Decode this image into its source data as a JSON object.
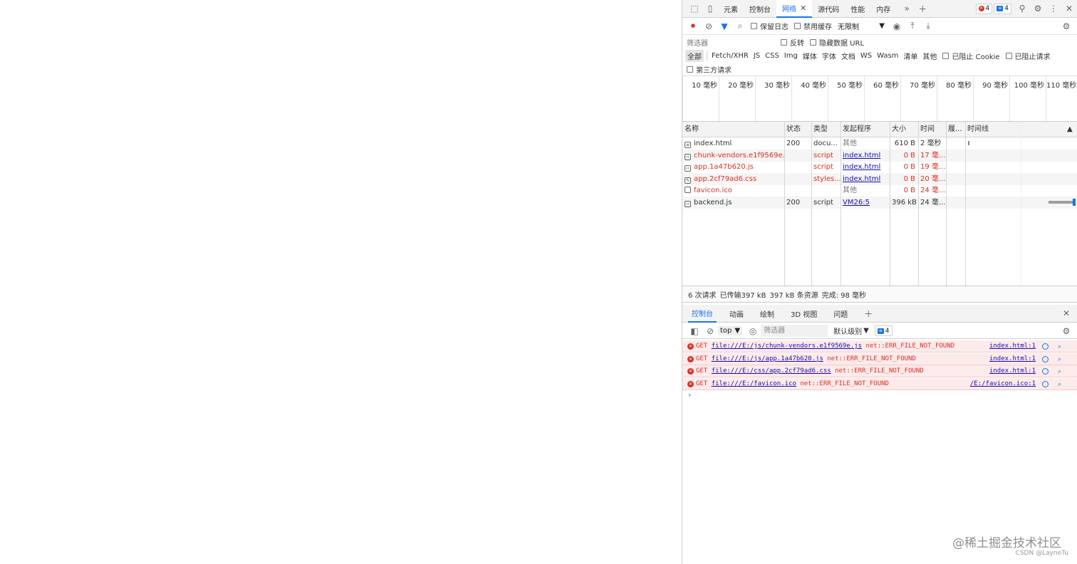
{
  "colors": {
    "accent": "#1a73e8",
    "error": "#d93025",
    "error_bg": "#fcebeb",
    "link": "#1a0dab"
  },
  "tabs": [
    {
      "label": "元素"
    },
    {
      "label": "控制台"
    },
    {
      "label": "网络",
      "active": true
    },
    {
      "label": "源代码"
    },
    {
      "label": "性能"
    },
    {
      "label": "内存"
    }
  ],
  "badges": {
    "errors": "4",
    "messages": "4"
  },
  "toolbar": {
    "preserve_log": "保留日志",
    "disable_cache": "禁用缓存",
    "throttle": "无限制"
  },
  "filter": {
    "placeholder": "筛选器",
    "invert": "反转",
    "hide_data_urls": "隐藏数据 URL"
  },
  "types": [
    "全部",
    "Fetch/XHR",
    "JS",
    "CSS",
    "Img",
    "媒体",
    "字体",
    "文档",
    "WS",
    "Wasm",
    "清单",
    "其他"
  ],
  "blocked_cookies": "已阻止 Cookie",
  "blocked_requests": "已阻止请求",
  "third_party": "第三方请求",
  "overview_ticks": [
    "10 毫秒",
    "20 毫秒",
    "30 毫秒",
    "40 毫秒",
    "50 毫秒",
    "60 毫秒",
    "70 毫秒",
    "80 毫秒",
    "90 毫秒",
    "100 毫秒",
    "110 毫秒"
  ],
  "columns": {
    "name": "名称",
    "status": "状态",
    "type": "类型",
    "initiator": "发起程序",
    "size": "大小",
    "time": "时间",
    "priority": "履...",
    "waterfall": "时间线"
  },
  "rows": [
    {
      "name": "index.html",
      "status": "200",
      "type": "docu...",
      "initiator": "其他",
      "size": "610 B",
      "time": "2 毫秒",
      "error": false
    },
    {
      "name": "chunk-vendors.e1f9569e.js",
      "status": "",
      "type": "script",
      "initiator": "index.html",
      "size": "0 B",
      "time": "17 毫...",
      "error": true
    },
    {
      "name": "app.1a47b620.js",
      "status": "",
      "type": "script",
      "initiator": "index.html",
      "size": "0 B",
      "time": "19 毫...",
      "error": true
    },
    {
      "name": "app.2cf79ad6.css",
      "status": "",
      "type": "styles...",
      "initiator": "index.html",
      "size": "0 B",
      "time": "20 毫...",
      "error": true
    },
    {
      "name": "favicon.ico",
      "status": "",
      "type": "",
      "initiator": "其他",
      "size": "0 B",
      "time": "24 毫...",
      "error": true
    },
    {
      "name": "backend.js",
      "status": "200",
      "type": "script",
      "initiator": "VM26:5",
      "size": "396 kB",
      "time": "24 毫...",
      "error": false
    }
  ],
  "summary": {
    "requests": "6 次请求",
    "transferred": "已传输397 kB",
    "resources": "397 kB 条资源",
    "finish": "完成: 98 毫秒"
  },
  "drawer_tabs": [
    "控制台",
    "动画",
    "绘制",
    "3D 视图",
    "问题"
  ],
  "console": {
    "context": "top",
    "filter_placeholder": "筛选器",
    "level": "默认级别",
    "issues_count": "4",
    "messages": [
      {
        "method": "GET",
        "url": "file:///E:/js/chunk-vendors.e1f9569e.js",
        "error": "net::ERR_FILE_NOT_FOUND",
        "source": "index.html:1"
      },
      {
        "method": "GET",
        "url": "file:///E:/js/app.1a47b620.js",
        "error": "net::ERR_FILE_NOT_FOUND",
        "source": "index.html:1"
      },
      {
        "method": "GET",
        "url": "file:///E:/css/app.2cf79ad6.css",
        "error": "net::ERR_FILE_NOT_FOUND",
        "source": "index.html:1"
      },
      {
        "method": "GET",
        "url": "file:///E:/favicon.ico",
        "error": "net::ERR_FILE_NOT_FOUND",
        "source": "/E:/favicon.ico:1"
      }
    ]
  },
  "watermark": {
    "main": "@稀土掘金技术社区",
    "sub": "CSDN @LayneTu"
  }
}
